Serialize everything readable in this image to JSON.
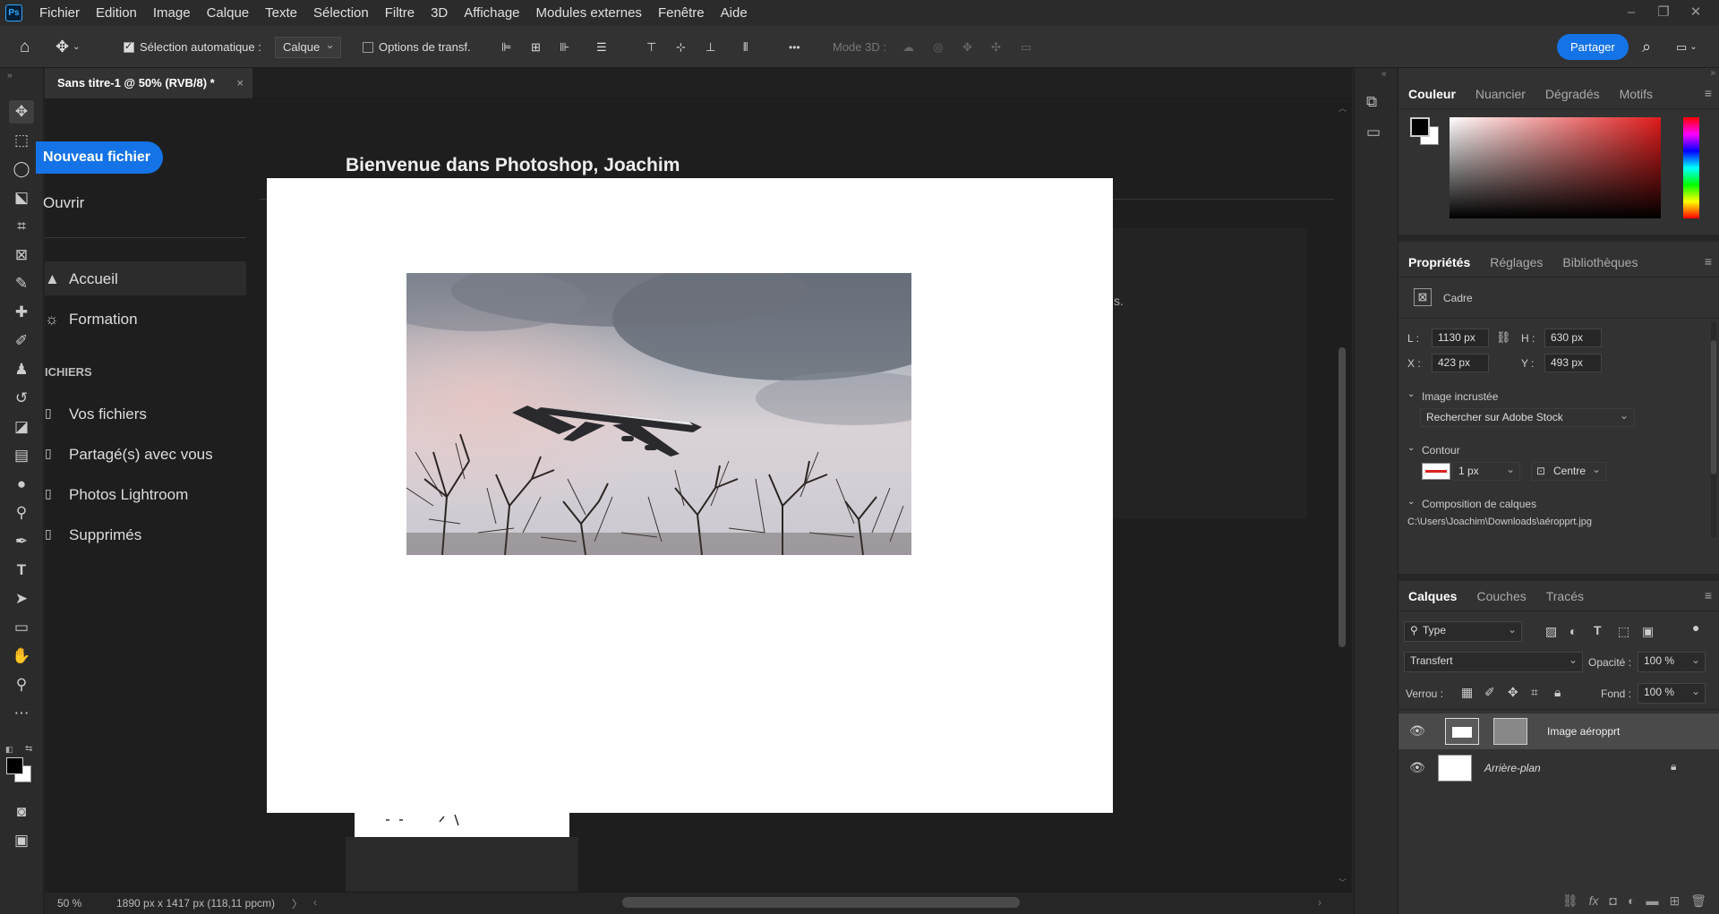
{
  "app": {
    "logo": "Ps"
  },
  "menubar": {
    "items": [
      "Fichier",
      "Edition",
      "Image",
      "Calque",
      "Texte",
      "Sélection",
      "Filtre",
      "3D",
      "Affichage",
      "Modules externes",
      "Fenêtre",
      "Aide"
    ],
    "window_controls": [
      "–",
      "❐",
      "✕"
    ]
  },
  "options_bar": {
    "auto_select_label": "Sélection automatique :",
    "auto_select_value": "Calque",
    "transform_label": "Options de transf.",
    "mode3d_label": "Mode 3D :",
    "more": "•••",
    "share_label": "Partager"
  },
  "document": {
    "tab_title": "Sans titre-1 @ 50% (RVB/8) *",
    "close": "×"
  },
  "home": {
    "new_file": "Nouveau fichier",
    "open": "Ouvrir",
    "welcome": "Bienvenue dans Photoshop, Joachim",
    "nav": [
      {
        "label": "Accueil",
        "icon": "home-icon"
      },
      {
        "label": "Formation",
        "icon": "lightbulb-icon"
      }
    ],
    "files_header": "ICHIERS",
    "files": [
      {
        "label": "Vos fichiers"
      },
      {
        "label": "Partagé(s) avec vous"
      },
      {
        "label": "Photos Lightroom"
      },
      {
        "label": "Supprimés"
      }
    ],
    "card_tail_text": "s."
  },
  "status": {
    "zoom": "50 %",
    "doc_info": "1890 px x 1417 px (118,11 ppcm)",
    "arrow": "〉"
  },
  "color_panel": {
    "tabs": [
      "Couleur",
      "Nuancier",
      "Dégradés",
      "Motifs"
    ],
    "foreground": "#000000",
    "background": "#ffffff"
  },
  "properties_panel": {
    "tabs": [
      "Propriétés",
      "Réglages",
      "Bibliothèques"
    ],
    "type_label": "Cadre",
    "L_label": "L :",
    "L_value": "1130 px",
    "H_label": "H :",
    "H_value": "630 px",
    "X_label": "X :",
    "X_value": "423 px",
    "Y_label": "Y :",
    "Y_value": "493 px",
    "embedded_label": "Image incrustée",
    "embedded_select": "Rechercher sur Adobe Stock",
    "contour_label": "Contour",
    "contour_size": "1 px",
    "contour_align": "Centre",
    "comp_label": "Composition de calques",
    "comp_path": "C:\\Users\\Joachim\\Downloads\\aéropprt.jpg"
  },
  "layers_panel": {
    "tabs": [
      "Calques",
      "Couches",
      "Tracés"
    ],
    "filter_type": "Type",
    "blend_mode": "Transfert",
    "opacity_label": "Opacité :",
    "opacity_value": "100 %",
    "lock_label": "Verrou :",
    "fill_label": "Fond :",
    "fill_value": "100 %",
    "layers": [
      {
        "name": "Image aéropprt",
        "selected": true
      },
      {
        "name": "Arrière-plan",
        "italic": true,
        "locked": true
      }
    ]
  }
}
